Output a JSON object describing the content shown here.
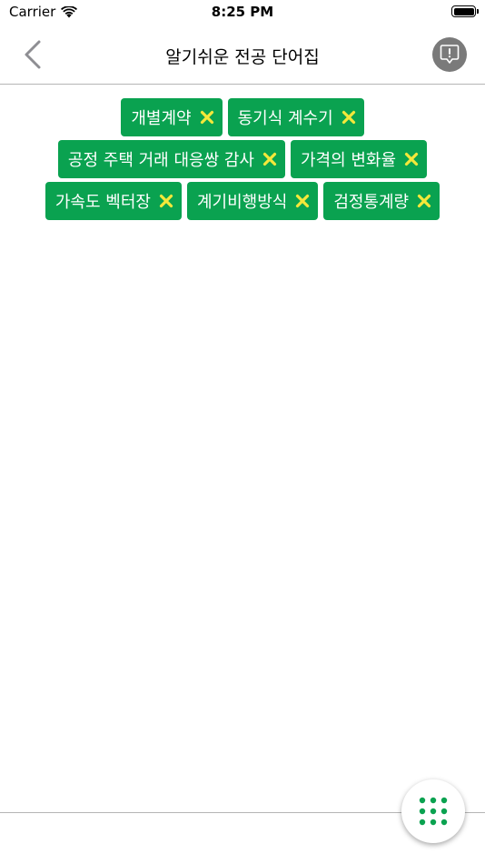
{
  "status_bar": {
    "carrier": "Carrier",
    "time": "8:25 PM"
  },
  "nav": {
    "title": "알기쉬운 전공 단어집",
    "back_icon": "chevron-left-icon",
    "report_icon": "alert-badge-icon"
  },
  "tags": [
    {
      "label": "개별계약"
    },
    {
      "label": "동기식 계수기"
    },
    {
      "label": "공정 주택 거래 대응쌍 감사"
    },
    {
      "label": "가격의 변화율"
    },
    {
      "label": "가속도 벡터장"
    },
    {
      "label": "계기비행방식"
    },
    {
      "label": "검정통계량"
    }
  ],
  "fab": {
    "icon": "grid-dots-icon"
  },
  "colors": {
    "tag_background": "#0aa250",
    "tag_text": "#ffffff",
    "tag_remove": "#f4e83a",
    "fab_dots": "#0aa250",
    "report_button": "#7a7a7a"
  }
}
